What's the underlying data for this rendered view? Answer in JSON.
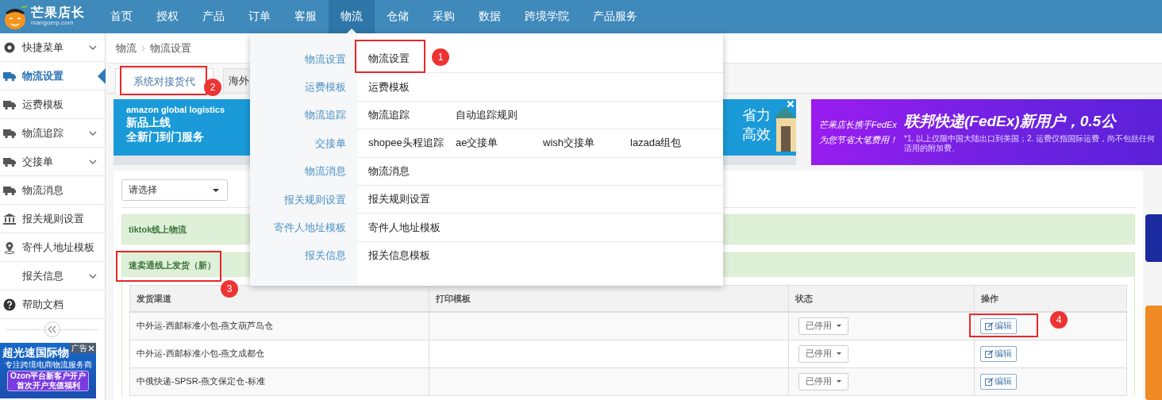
{
  "header": {
    "logo": {
      "name": "芒果店长",
      "domain": "mangoerp.com"
    },
    "nav": [
      {
        "label": "首页",
        "selected": false
      },
      {
        "label": "授权",
        "selected": false
      },
      {
        "label": "产品",
        "selected": false
      },
      {
        "label": "订单",
        "selected": false
      },
      {
        "label": "客服",
        "selected": false
      },
      {
        "label": "物流",
        "selected": true
      },
      {
        "label": "仓储",
        "selected": false
      },
      {
        "label": "采购",
        "selected": false
      },
      {
        "label": "数据",
        "selected": false
      },
      {
        "label": "跨境学院",
        "selected": false
      },
      {
        "label": "产品服务",
        "selected": false
      }
    ]
  },
  "sidebar": {
    "items": [
      {
        "label": "快捷菜单",
        "expandable": true,
        "selected": false
      },
      {
        "label": "物流设置",
        "expandable": false,
        "selected": true
      },
      {
        "label": "运费模板",
        "expandable": false,
        "selected": false
      },
      {
        "label": "物流追踪",
        "expandable": true,
        "selected": false
      },
      {
        "label": "交接单",
        "expandable": true,
        "selected": false
      },
      {
        "label": "物流消息",
        "expandable": false,
        "selected": false
      },
      {
        "label": "报关规则设置",
        "expandable": false,
        "selected": false
      },
      {
        "label": "寄件人地址模板",
        "expandable": false,
        "selected": false
      },
      {
        "label": "报关信息",
        "expandable": true,
        "selected": false
      },
      {
        "label": "帮助文档",
        "expandable": false,
        "selected": false
      }
    ],
    "ad": {
      "title": "超光速国际物",
      "subtitle": "专注跨境电商物流服务商",
      "offer": [
        "Ozon平台新客户开户",
        "首次开户充值福利"
      ],
      "tag": "广告"
    }
  },
  "breadcrumb": [
    "物流",
    "物流设置"
  ],
  "tabs": [
    {
      "label": "系统对接货代",
      "selected": true
    },
    {
      "label": "海外",
      "selected": false
    }
  ],
  "banners": [
    {
      "kind": "amazon",
      "brand": "amazon global logistics",
      "lines": [
        "新品上线",
        "全新门到门服务"
      ],
      "side_lines": [
        "省力",
        "高效"
      ]
    },
    {
      "kind": "fedex",
      "lines": [
        "芒果店长携手FedEx",
        "为您节省大笔费用！"
      ],
      "headline": "联邦快递(FedEx)新用户，0.5公",
      "footnote": "*1. 以上仅限中国大陆出口到美国；2. 运费仅指国际运费，尚不包括任何适用的附加费、"
    }
  ],
  "panel": {
    "select": {
      "placeholder": "请选择"
    },
    "sections": [
      {
        "title": "tiktok线上物流"
      },
      {
        "title": "速卖通线上发货（新）",
        "table": {
          "columns": [
            "发货渠道",
            "打印模板",
            "状态",
            "操作"
          ],
          "rows": [
            {
              "channel": "中外运-西邮标准小包-燕文葫芦岛仓",
              "status": "已停用",
              "action": "编辑"
            },
            {
              "channel": "中外运-西邮标准小包-燕文成都仓",
              "status": "已停用",
              "action": "编辑"
            },
            {
              "channel": "中俄快递-SPSR-燕文保定仓-标准",
              "status": "已停用",
              "action": "编辑"
            }
          ]
        }
      }
    ]
  },
  "menu": {
    "rows": [
      {
        "heading": "物流设置",
        "links": [
          "物流设置"
        ]
      },
      {
        "heading": "运费模板",
        "links": [
          "运费模板"
        ]
      },
      {
        "heading": "物流追踪",
        "links": [
          "物流追踪",
          "自动追踪规则"
        ]
      },
      {
        "heading": "交接单",
        "links": [
          "shopee头程追踪",
          "ae交接单",
          "wish交接单",
          "lazada组包"
        ]
      },
      {
        "heading": "物流消息",
        "links": [
          "物流消息"
        ]
      },
      {
        "heading": "报关规则设置",
        "links": [
          "报关规则设置"
        ]
      },
      {
        "heading": "寄件人地址模板",
        "links": [
          "寄件人地址模板"
        ]
      },
      {
        "heading": "报关信息",
        "links": [
          "报关信息模板"
        ]
      }
    ]
  },
  "annotations": [
    {
      "number": "1"
    },
    {
      "number": "2"
    },
    {
      "number": "3"
    },
    {
      "number": "4"
    }
  ]
}
